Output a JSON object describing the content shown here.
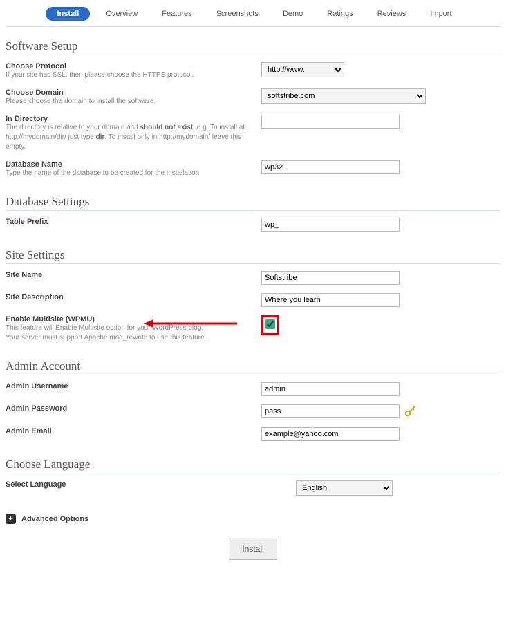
{
  "tabs": {
    "install": "Install",
    "overview": "Overview",
    "features": "Features",
    "screenshots": "Screenshots",
    "demo": "Demo",
    "ratings": "Ratings",
    "reviews": "Reviews",
    "import": "Import"
  },
  "sections": {
    "software_setup": "Software Setup",
    "database_settings": "Database Settings",
    "site_settings": "Site Settings",
    "admin_account": "Admin Account",
    "choose_language": "Choose Language"
  },
  "fields": {
    "protocol_label": "Choose Protocol",
    "protocol_help": "If your site has SSL, then please choose the HTTPS protocol.",
    "protocol_value": "http://www.",
    "domain_label": "Choose Domain",
    "domain_help": "Please choose the domain to install the software.",
    "domain_value": "softstribe.com",
    "directory_label": "In Directory",
    "directory_help1": "The directory is relative to your domain and ",
    "directory_help1b": "should not exist",
    "directory_help2": ". e.g. To install at http://mydomain/dir/ just type ",
    "directory_help2b": "dir",
    "directory_help3": ". To install only in http://mydomain/ leave this empty.",
    "directory_value": "",
    "dbname_label": "Database Name",
    "dbname_help": "Type the name of the database to be created for the installation",
    "dbname_value": "wp32",
    "prefix_label": "Table Prefix",
    "prefix_value": "wp_",
    "sitename_label": "Site Name",
    "sitename_value": "Softstribe",
    "sitedesc_label": "Site Description",
    "sitedesc_value": "Where you learn",
    "multisite_label": "Enable Multisite (WPMU)",
    "multisite_help1": "This feature will Enable Multisite option for your WordPress blog.",
    "multisite_help2": "Your server must support Apache mod_rewrite to use this feature.",
    "admin_user_label": "Admin Username",
    "admin_user_value": "admin",
    "admin_pass_label": "Admin Password",
    "admin_pass_value": "pass",
    "admin_email_label": "Admin Email",
    "admin_email_value": "example@yahoo.com",
    "lang_label": "Select Language",
    "lang_value": "English"
  },
  "advanced_label": "Advanced Options",
  "install_button": "Install"
}
